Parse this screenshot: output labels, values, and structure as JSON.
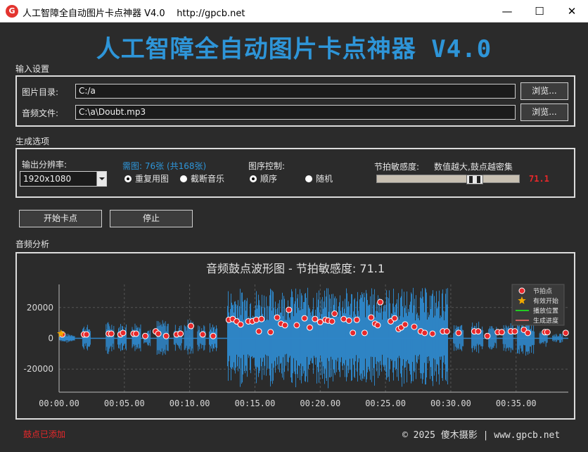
{
  "window": {
    "title": "人工智障全自动图片卡点神器 V4.0    http://gpcb.net",
    "icon_letter": "G",
    "minimize_glyph": "—",
    "maximize_glyph": "☐",
    "close_glyph": "✕"
  },
  "header": {
    "title": "人工智障全自动图片卡点神器 V4.0"
  },
  "input_settings": {
    "section_label": "输入设置",
    "image_dir_label": "图片目录:",
    "image_dir_value": "C:/a",
    "audio_file_label": "音频文件:",
    "audio_file_value": "C:\\a\\Doubt.mp3",
    "browse_label": "浏览..."
  },
  "options": {
    "section_label": "生成选项",
    "resolution_label": "输出分辨率:",
    "resolution_value": "1920x1080",
    "need_text": "需图: 76张 (共168张)",
    "reuse_label": "重复用图",
    "cut_label": "截断音乐",
    "reuse_selected": true,
    "order_label": "图序控制:",
    "sequential_label": "顺序",
    "random_label": "随机",
    "sequential_selected": true,
    "sensitivity_label": "节拍敏感度:",
    "sensitivity_hint": "数值越大,鼓点越密集",
    "sensitivity_value": "71.1",
    "sensitivity_fraction": 0.711
  },
  "actions": {
    "start_label": "开始卡点",
    "stop_label": "停止"
  },
  "analysis": {
    "section_label": "音频分析"
  },
  "chart_data": {
    "type": "line",
    "title": "音频鼓点波形图 - 节拍敏感度: 71.1",
    "xlabel": "",
    "ylabel": "",
    "xlim": [
      0,
      39
    ],
    "ylim": [
      -35000,
      35000
    ],
    "x_ticks": [
      "00:00.00",
      "00:05.00",
      "00:10.00",
      "00:15.00",
      "00:20.00",
      "00:25.00",
      "00:30.00",
      "00:35.00"
    ],
    "x_tick_values": [
      0,
      5,
      10,
      15,
      20,
      25,
      30,
      35
    ],
    "y_ticks": [
      20000,
      0,
      -20000
    ],
    "grid": true,
    "legend_position": "top-right",
    "legend": [
      "节拍点",
      "有效开始",
      "播放位置",
      "生成进度"
    ],
    "colors": {
      "waveform": "#2f86c8",
      "beat": "#e8282b",
      "start": "#f0a800",
      "playhead": "#22cc22",
      "progress": "#d06060"
    },
    "waveform_segments": [
      {
        "start": 0.0,
        "end": 1.2,
        "amp": 3000
      },
      {
        "start": 1.8,
        "end": 2.4,
        "amp": 9000
      },
      {
        "start": 3.6,
        "end": 4.2,
        "amp": 11000
      },
      {
        "start": 4.5,
        "end": 5.2,
        "amp": 10000
      },
      {
        "start": 5.6,
        "end": 6.3,
        "amp": 11000
      },
      {
        "start": 6.5,
        "end": 7.0,
        "amp": 7000
      },
      {
        "start": 7.5,
        "end": 8.4,
        "amp": 12000
      },
      {
        "start": 8.8,
        "end": 9.4,
        "amp": 9000
      },
      {
        "start": 9.6,
        "end": 10.3,
        "amp": 13000
      },
      {
        "start": 10.6,
        "end": 11.2,
        "amp": 9000
      },
      {
        "start": 11.5,
        "end": 12.1,
        "amp": 10000
      },
      {
        "start": 12.9,
        "end": 29.8,
        "amp": 33000
      },
      {
        "start": 30.2,
        "end": 31.0,
        "amp": 9000
      },
      {
        "start": 31.6,
        "end": 32.5,
        "amp": 11000
      },
      {
        "start": 32.9,
        "end": 33.5,
        "amp": 8000
      },
      {
        "start": 34.0,
        "end": 34.8,
        "amp": 10000
      },
      {
        "start": 35.1,
        "end": 36.4,
        "amp": 12000
      },
      {
        "start": 36.8,
        "end": 37.4,
        "amp": 6000
      },
      {
        "start": 37.8,
        "end": 38.6,
        "amp": 3000
      }
    ],
    "beats": [
      {
        "x": 0.25,
        "y": 2500
      },
      {
        "x": 1.9,
        "y": 2500
      },
      {
        "x": 2.1,
        "y": 2500
      },
      {
        "x": 3.8,
        "y": 3000
      },
      {
        "x": 4.0,
        "y": 3000
      },
      {
        "x": 4.7,
        "y": 2500
      },
      {
        "x": 4.9,
        "y": 3500
      },
      {
        "x": 5.7,
        "y": 3000
      },
      {
        "x": 5.9,
        "y": 3000
      },
      {
        "x": 6.6,
        "y": 1500
      },
      {
        "x": 7.4,
        "y": 4500
      },
      {
        "x": 7.6,
        "y": 3000
      },
      {
        "x": 8.2,
        "y": 1500
      },
      {
        "x": 9.0,
        "y": 2500
      },
      {
        "x": 9.3,
        "y": 3000
      },
      {
        "x": 10.1,
        "y": 8000
      },
      {
        "x": 11.0,
        "y": 2500
      },
      {
        "x": 11.8,
        "y": 1500
      },
      {
        "x": 13.0,
        "y": 12000
      },
      {
        "x": 13.3,
        "y": 12500
      },
      {
        "x": 13.6,
        "y": 11000
      },
      {
        "x": 13.9,
        "y": 9000
      },
      {
        "x": 14.5,
        "y": 11000
      },
      {
        "x": 14.8,
        "y": 11000
      },
      {
        "x": 15.1,
        "y": 12000
      },
      {
        "x": 15.3,
        "y": 4500
      },
      {
        "x": 15.5,
        "y": 12500
      },
      {
        "x": 16.2,
        "y": 4000
      },
      {
        "x": 16.7,
        "y": 13500
      },
      {
        "x": 17.0,
        "y": 9500
      },
      {
        "x": 17.3,
        "y": 8500
      },
      {
        "x": 17.6,
        "y": 18500
      },
      {
        "x": 18.2,
        "y": 8500
      },
      {
        "x": 18.8,
        "y": 13000
      },
      {
        "x": 19.2,
        "y": 7000
      },
      {
        "x": 19.6,
        "y": 12500
      },
      {
        "x": 20.0,
        "y": 10500
      },
      {
        "x": 20.4,
        "y": 12000
      },
      {
        "x": 20.6,
        "y": 11500
      },
      {
        "x": 20.9,
        "y": 11000
      },
      {
        "x": 21.1,
        "y": 16000
      },
      {
        "x": 21.8,
        "y": 12500
      },
      {
        "x": 22.2,
        "y": 11500
      },
      {
        "x": 22.5,
        "y": 3500
      },
      {
        "x": 22.8,
        "y": 12000
      },
      {
        "x": 23.4,
        "y": 3500
      },
      {
        "x": 23.9,
        "y": 13500
      },
      {
        "x": 24.2,
        "y": 9500
      },
      {
        "x": 24.4,
        "y": 8500
      },
      {
        "x": 24.6,
        "y": 23500
      },
      {
        "x": 25.4,
        "y": 11000
      },
      {
        "x": 25.7,
        "y": 13000
      },
      {
        "x": 26.0,
        "y": 6000
      },
      {
        "x": 26.2,
        "y": 7000
      },
      {
        "x": 26.5,
        "y": 9000
      },
      {
        "x": 27.2,
        "y": 7500
      },
      {
        "x": 27.7,
        "y": 4500
      },
      {
        "x": 28.0,
        "y": 3500
      },
      {
        "x": 28.6,
        "y": 3000
      },
      {
        "x": 29.4,
        "y": 4500
      },
      {
        "x": 29.7,
        "y": 4500
      },
      {
        "x": 30.6,
        "y": 3500
      },
      {
        "x": 31.8,
        "y": 4500
      },
      {
        "x": 32.1,
        "y": 4500
      },
      {
        "x": 32.8,
        "y": 1500
      },
      {
        "x": 33.6,
        "y": 4000
      },
      {
        "x": 33.9,
        "y": 4000
      },
      {
        "x": 34.6,
        "y": 4500
      },
      {
        "x": 34.9,
        "y": 4500
      },
      {
        "x": 35.6,
        "y": 5500
      },
      {
        "x": 35.9,
        "y": 3500
      },
      {
        "x": 37.2,
        "y": 4000
      },
      {
        "x": 37.4,
        "y": 4000
      },
      {
        "x": 38.8,
        "y": 3500
      }
    ],
    "start_marker": {
      "x": 0.15,
      "y": 3000
    }
  },
  "status": {
    "text": "鼓点已添加"
  },
  "footer": {
    "text": "© 2025 傻木摄影 | www.gpcb.net"
  }
}
